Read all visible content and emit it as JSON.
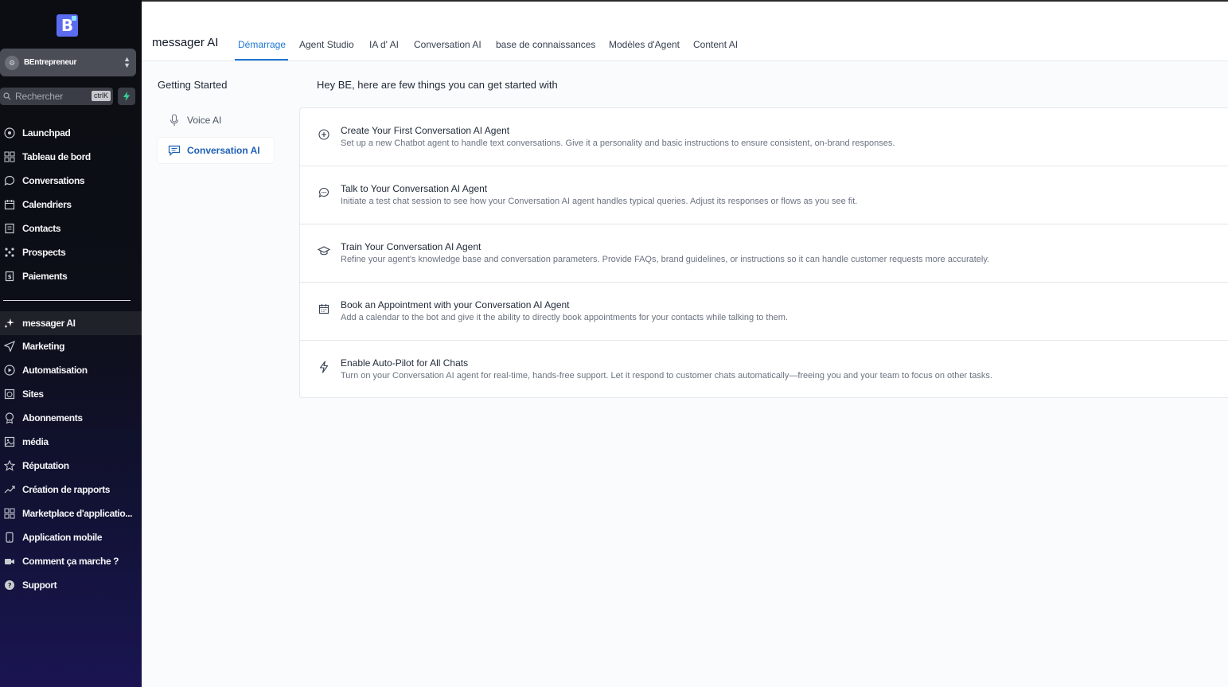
{
  "colors": {
    "accent": "#1d76d2",
    "sidebar_bg": "#0b0d12",
    "logo": "#5b6cf0",
    "bolt": "#34d399"
  },
  "sidebar": {
    "logo_letter": "B",
    "account": {
      "avatar_icon": "user-icon",
      "name": "BEntrepreneur"
    },
    "search": {
      "placeholder": "Rechercher",
      "shortcut": "ctrlK"
    },
    "items_top": [
      {
        "label": "Launchpad",
        "icon": "launchpad-icon"
      },
      {
        "label": "Tableau de bord",
        "icon": "dashboard-icon"
      },
      {
        "label": "Conversations",
        "icon": "chat-icon"
      },
      {
        "label": "Calendriers",
        "icon": "calendar-icon"
      },
      {
        "label": "Contacts",
        "icon": "contacts-icon"
      },
      {
        "label": "Prospects",
        "icon": "pipeline-icon"
      },
      {
        "label": "Paiements",
        "icon": "receipt-icon"
      }
    ],
    "items_bottom": [
      {
        "label": "messager AI",
        "icon": "sparkle-icon",
        "active": true
      },
      {
        "label": "Marketing",
        "icon": "send-icon"
      },
      {
        "label": "Automatisation",
        "icon": "automation-icon"
      },
      {
        "label": "Sites",
        "icon": "globe-icon"
      },
      {
        "label": "Abonnements",
        "icon": "badge-icon"
      },
      {
        "label": "média",
        "icon": "image-icon"
      },
      {
        "label": "Réputation",
        "icon": "star-icon"
      },
      {
        "label": "Création de rapports",
        "icon": "trend-icon"
      },
      {
        "label": "Marketplace d'applicatio...",
        "icon": "apps-icon"
      },
      {
        "label": "Application mobile",
        "icon": "mobile-icon"
      },
      {
        "label": "Comment ça marche ?",
        "icon": "video-icon"
      },
      {
        "label": "Support",
        "icon": "help-icon"
      }
    ]
  },
  "header": {
    "title": "messager AI",
    "tabs": [
      {
        "label": "Démarrage",
        "active": true
      },
      {
        "label": "Agent Studio"
      },
      {
        "label": "IA d' AI"
      },
      {
        "label": "Conversation AI"
      },
      {
        "label": "base de connaissances"
      },
      {
        "label": "Modèles d'Agent"
      },
      {
        "label": "Content AI"
      }
    ]
  },
  "subnav": {
    "title": "Getting Started",
    "items": [
      {
        "label": "Voice AI",
        "icon": "microphone-icon"
      },
      {
        "label": "Conversation AI",
        "icon": "message-icon",
        "active": true
      }
    ]
  },
  "main": {
    "intro": "Hey BE, here are few things you can get started with",
    "cards": [
      {
        "icon": "plus-circle-icon",
        "title": "Create Your First Conversation AI Agent",
        "desc": "Set up a new Chatbot agent to handle text conversations. Give it a personality and basic instructions to ensure consistent, on-brand responses."
      },
      {
        "icon": "chat-bubble-icon",
        "title": "Talk to Your Conversation AI Agent",
        "desc": "Initiate a test chat session to see how your Conversation AI agent handles typical queries. Adjust its responses or flows as you see fit."
      },
      {
        "icon": "graduation-cap-icon",
        "title": "Train Your Conversation AI Agent",
        "desc": "Refine your agent's knowledge base and conversation parameters. Provide FAQs, brand guidelines, or instructions so it can handle customer requests more accurately."
      },
      {
        "icon": "calendar-icon",
        "title": "Book an Appointment with your Conversation AI Agent",
        "desc": "Add a calendar to the bot and give it the ability to directly book appointments for your contacts while talking to them."
      },
      {
        "icon": "lightning-icon",
        "title": "Enable Auto-Pilot for All Chats",
        "desc": "Turn on your Conversation AI agent for real-time, hands-free support. Let it respond to customer chats automatically—freeing you and your team to focus on other tasks."
      }
    ]
  }
}
